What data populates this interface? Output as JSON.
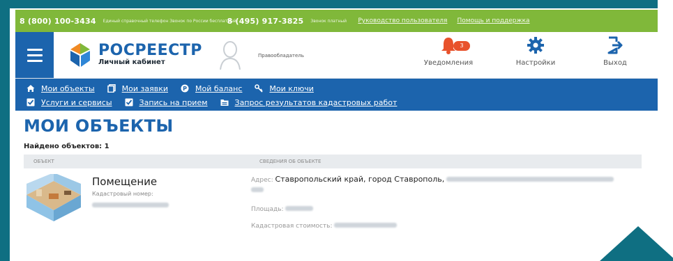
{
  "topbar": {
    "phone1": "8 (800) 100-3434",
    "phone1_note": "Единый справочный телефон Звонок по России бесплатный",
    "phone2": "8 (495) 917-3825",
    "phone2_note": "Звонок платный",
    "link_guide": "Руководство пользователя",
    "link_support": "Помощь и поддержка"
  },
  "header": {
    "logo_title": "РОСРЕЕСТР",
    "logo_sub": "Личный кабинет",
    "role": "Правообладатель",
    "notifications_label": "Уведомления",
    "notifications_count": "3",
    "settings_label": "Настройки",
    "logout_label": "Выход"
  },
  "nav": {
    "row1": [
      {
        "label": "Мои объекты",
        "icon": "home-icon"
      },
      {
        "label": "Мои заявки",
        "icon": "documents-icon"
      },
      {
        "label": "Мой баланс",
        "icon": "balance-icon"
      },
      {
        "label": "Мои ключи",
        "icon": "key-icon"
      }
    ],
    "row2": [
      {
        "label": "Услуги и сервисы",
        "icon": "checkbox-icon"
      },
      {
        "label": "Запись на прием",
        "icon": "checkbox-icon"
      },
      {
        "label": "Запрос результатов кадастровых работ",
        "icon": "folder-icon"
      }
    ]
  },
  "main": {
    "title": "МОИ ОБЪЕКТЫ",
    "found_label": "Найдено объектов: 1",
    "table": {
      "col_object": "ОБЪЕКТ",
      "col_info": "СВЕДЕНИЯ ОБ ОБЪЕКТЕ",
      "rows": [
        {
          "name": "Помещение",
          "cadastral_label": "Кадастровый номер:",
          "address_label": "Адрес:",
          "address_value": "Ставропольский край, город Ставрополь,",
          "area_label": "Площадь:",
          "cost_label": "Кадастровая стоимость:"
        }
      ]
    }
  },
  "colors": {
    "brand_blue": "#1c64ad",
    "green_bar": "#80b83a",
    "badge_orange": "#e8522c",
    "frame_teal": "#0f6f82"
  }
}
